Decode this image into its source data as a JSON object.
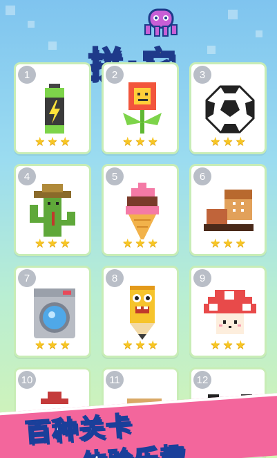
{
  "logo": {
    "title": "拼·它"
  },
  "levels": [
    {
      "number": "1",
      "name": "battery-icon",
      "stars": 3
    },
    {
      "number": "2",
      "name": "flower-icon",
      "stars": 3
    },
    {
      "number": "3",
      "name": "soccer-ball-icon",
      "stars": 3
    },
    {
      "number": "4",
      "name": "cactus-icon",
      "stars": 3
    },
    {
      "number": "5",
      "name": "ice-cream-icon",
      "stars": 3
    },
    {
      "number": "6",
      "name": "boot-icon",
      "stars": 3
    },
    {
      "number": "7",
      "name": "washing-machine-icon",
      "stars": 3
    },
    {
      "number": "8",
      "name": "pencil-icon",
      "stars": 3
    },
    {
      "number": "9",
      "name": "mushroom-icon",
      "stars": 3
    },
    {
      "number": "10",
      "name": "hat-icon",
      "stars": 0
    },
    {
      "number": "11",
      "name": "box-icon",
      "stars": 0
    },
    {
      "number": "12",
      "name": "panda-icon",
      "stars": 0
    }
  ],
  "banner": {
    "line1": "百种关卡",
    "line2": "体验乐趣"
  },
  "colors": {
    "star": "#f7c624",
    "banner": "#f3669c",
    "card_border": "#c8edb6"
  }
}
